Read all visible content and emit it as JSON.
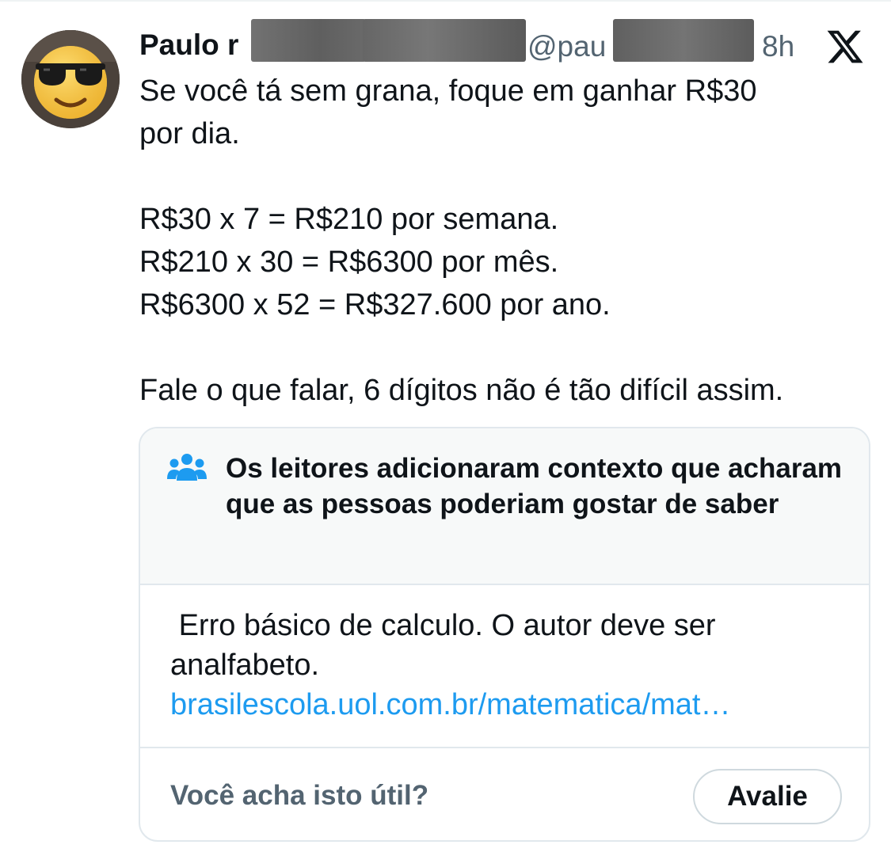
{
  "tweet": {
    "author_name": "Paulo r",
    "handle": "@pau",
    "time": "8h",
    "lines": [
      "Se você tá sem grana, foque em ganhar R$30",
      "por dia.",
      "",
      "R$30 x 7 = R$210 por semana.",
      "R$210 x 30 = R$6300 por mês.",
      "R$6300 x 52 = R$327.600 por ano.",
      "",
      "Fale o que falar, 6 dígitos não é tão difícil assim."
    ]
  },
  "community_note": {
    "title": "Os leitores adicionaram contexto que acharam que as pessoas poderiam gostar de saber",
    "body": " Erro básico de calculo. O autor deve ser analfabeto.",
    "link": "brasilescola.uol.com.br/matematica/mat…",
    "footer_question": "Você acha isto útil?",
    "rate_label": "Avalie"
  },
  "icons": {
    "avatar": "sunglasses-emoji-avatar",
    "brand": "x-logo-icon",
    "note": "people-icon"
  },
  "colors": {
    "text": "#0f1419",
    "secondary": "#536471",
    "link": "#1d9bf0",
    "note_header_bg": "#f7f9f9",
    "border": "#e1e8ed"
  }
}
